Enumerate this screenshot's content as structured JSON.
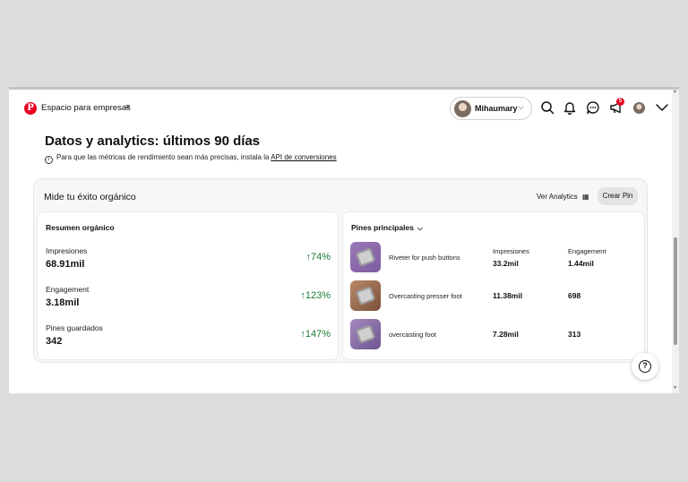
{
  "header": {
    "logo_glyph": "P",
    "brand": "Espacio para empresas",
    "menu_glyph": "≡",
    "account_name": "Mihaumary",
    "notification_count": "5"
  },
  "page": {
    "title": "Datos y analytics: últimos 90 días",
    "info_text": "Para que las métricas de rendimiento sean más precisas, instala la",
    "info_link": "API de conversiones"
  },
  "card": {
    "title": "Mide tu éxito orgánico",
    "ver_analytics": "Ver Analytics",
    "crear_pin": "Crear Pin"
  },
  "summary": {
    "heading": "Resumen orgánico",
    "metrics": [
      {
        "label": "Impresiones",
        "value": "68.91mil",
        "change": "↑74%"
      },
      {
        "label": "Engagement",
        "value": "3.18mil",
        "change": "↑123%"
      },
      {
        "label": "Pines guardados",
        "value": "342",
        "change": "↑147%"
      }
    ]
  },
  "top_pins": {
    "heading": "Pines principales",
    "pins": [
      {
        "title": "Riveter for push buttons",
        "impressions_label": "Impresiones",
        "impressions": "33.2mil",
        "engagement_label": "Engagement",
        "engagement": "1.44mil"
      },
      {
        "title": "Overcasting presser foot",
        "impressions": "11.38mil",
        "engagement": "698"
      },
      {
        "title": "overcasting foot",
        "impressions": "7.28mil",
        "engagement": "313"
      }
    ]
  },
  "colors": {
    "brand_red": "#e60023",
    "positive_green": "#1b7a35"
  }
}
